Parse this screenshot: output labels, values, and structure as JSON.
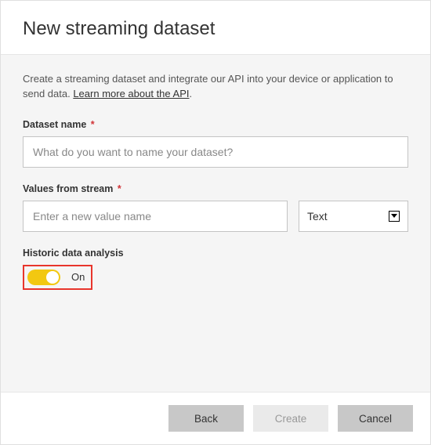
{
  "header": {
    "title": "New streaming dataset"
  },
  "intro": {
    "text_before_link": "Create a streaming dataset and integrate our API into your device or application to send data. ",
    "link_text": "Learn more about the API",
    "period": "."
  },
  "fields": {
    "dataset_name": {
      "label": "Dataset name",
      "required_marker": "*",
      "placeholder": "What do you want to name your dataset?",
      "value": ""
    },
    "values_from_stream": {
      "label": "Values from stream",
      "required_marker": "*",
      "placeholder": "Enter a new value name",
      "value": "",
      "type_selected": "Text"
    },
    "historic": {
      "label": "Historic data analysis",
      "state_label": "On"
    }
  },
  "footer": {
    "back": "Back",
    "create": "Create",
    "cancel": "Cancel"
  },
  "icons": {
    "chevron_down": "⌄"
  }
}
